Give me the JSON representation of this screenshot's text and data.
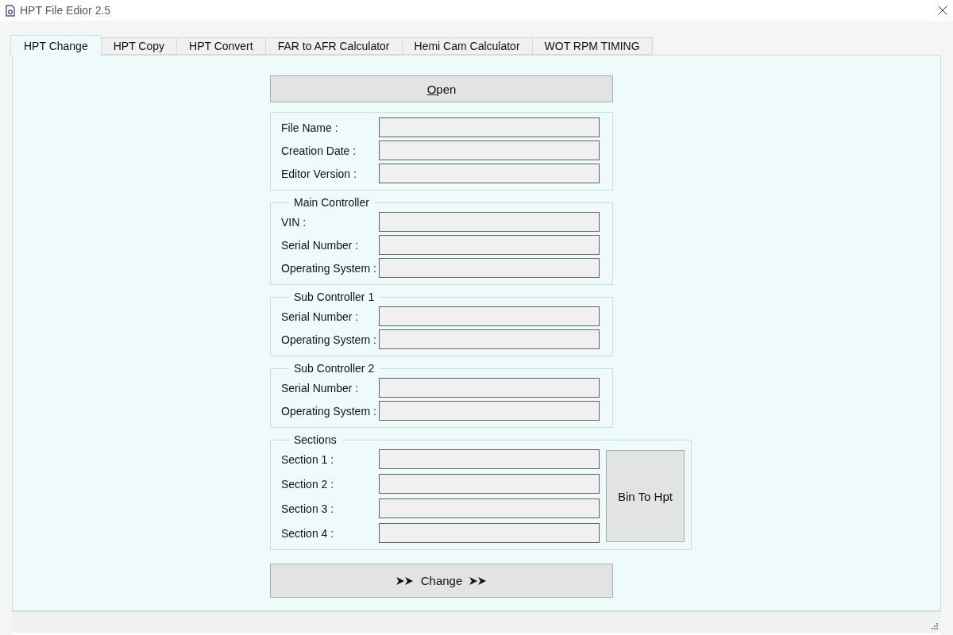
{
  "window": {
    "title": "HPT File Edior 2.5"
  },
  "tabs": [
    {
      "label": "HPT Change",
      "selected": true
    },
    {
      "label": "HPT Copy",
      "selected": false
    },
    {
      "label": "HPT Convert",
      "selected": false
    },
    {
      "label": "FAR to AFR Calculator",
      "selected": false
    },
    {
      "label": "Hemi Cam Calculator",
      "selected": false
    },
    {
      "label": "WOT RPM TIMING",
      "selected": false
    }
  ],
  "open_button": {
    "label": "Open",
    "mnemonic_underlined": true
  },
  "groups": [
    {
      "fields": [
        {
          "label": "File Name :"
        },
        {
          "label": "Creation Date :"
        },
        {
          "label": "Editor Version :"
        }
      ]
    },
    {
      "title": "Main Controller",
      "fields": [
        {
          "label": "VIN :"
        },
        {
          "label": "Serial Number :"
        },
        {
          "label": "Operating System :"
        }
      ]
    },
    {
      "title": "Sub Controller 1",
      "fields": [
        {
          "label": "Serial Number :"
        },
        {
          "label": "Operating System :"
        }
      ]
    },
    {
      "title": "Sub Controller 2",
      "fields": [
        {
          "label": "Serial Number :"
        },
        {
          "label": "Operating System :"
        }
      ]
    },
    {
      "title": "Sections",
      "fields": [
        {
          "label": "Section 1 :"
        },
        {
          "label": "Section 2 :"
        },
        {
          "label": "Section 3 :"
        },
        {
          "label": "Section 4 :"
        }
      ],
      "side_button": {
        "label": "Bin To Hpt"
      }
    }
  ],
  "change_button": {
    "label": "Change"
  }
}
